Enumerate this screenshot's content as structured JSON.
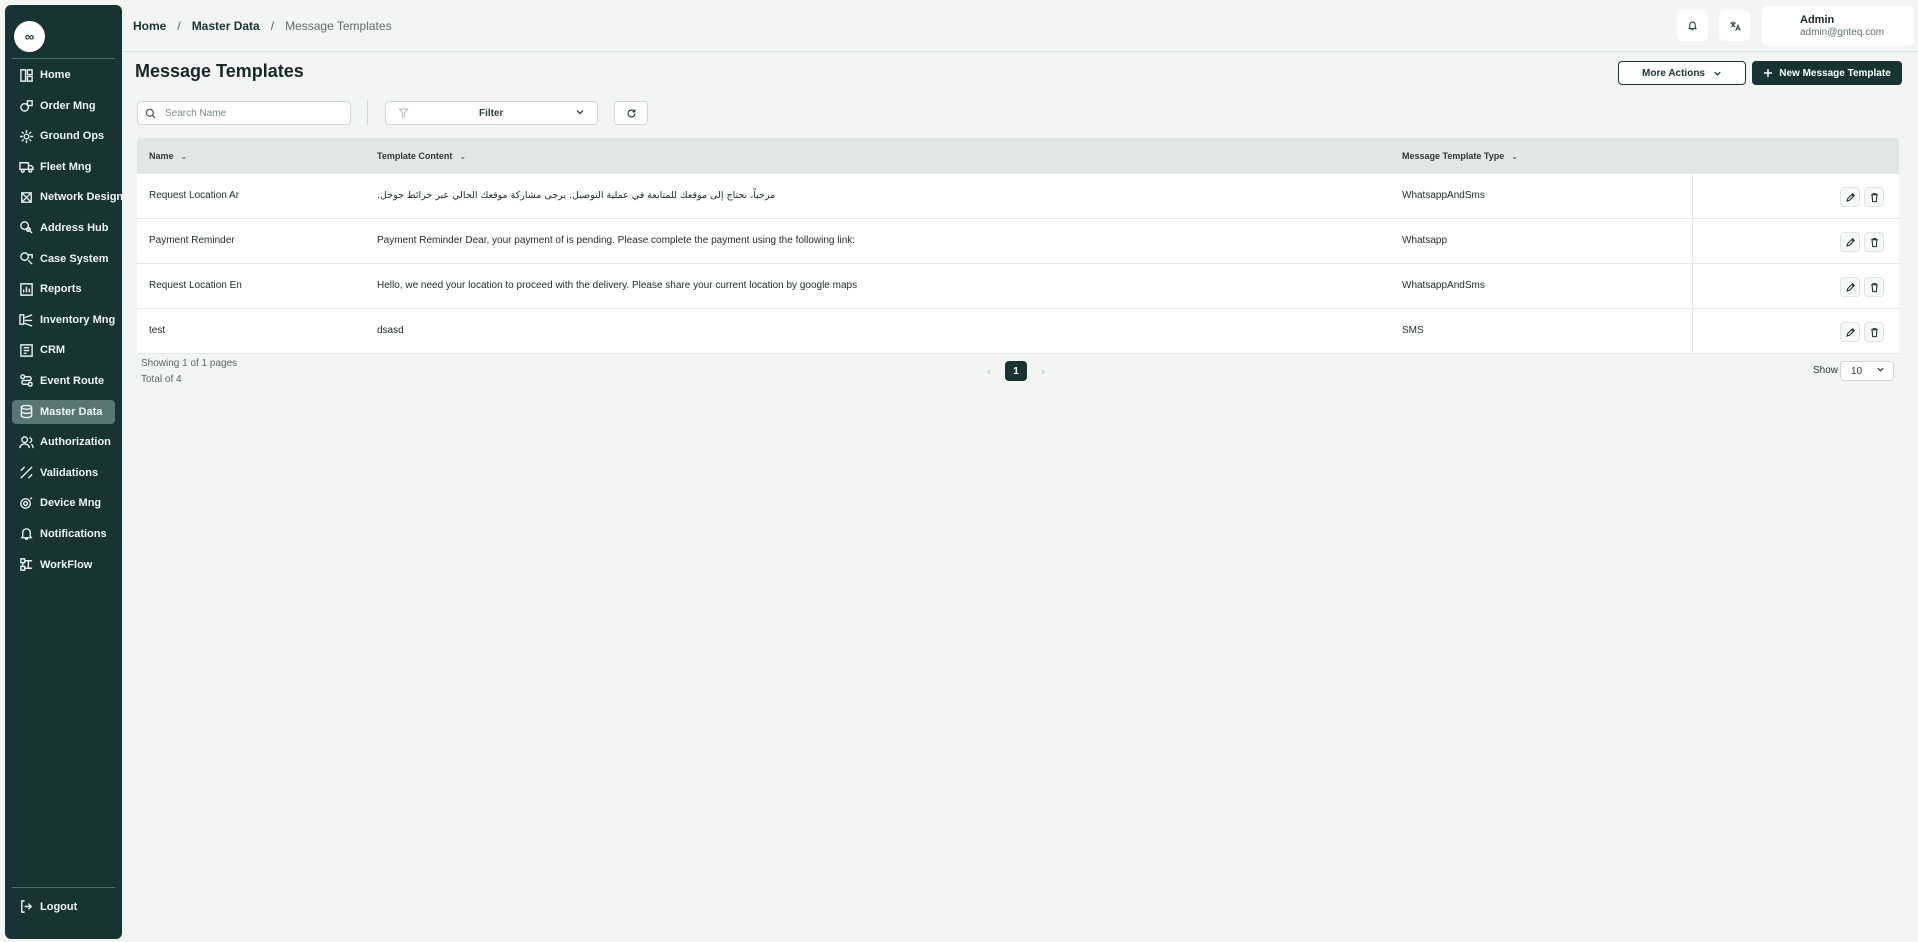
{
  "sidebar": {
    "logo_glyph": "∞",
    "items": [
      {
        "label": "Home",
        "icon": "home-icon"
      },
      {
        "label": "Order Mng",
        "icon": "order-icon"
      },
      {
        "label": "Ground Ops",
        "icon": "ground-ops-icon"
      },
      {
        "label": "Fleet Mng",
        "icon": "truck-icon"
      },
      {
        "label": "Network Design",
        "icon": "network-icon"
      },
      {
        "label": "Address Hub",
        "icon": "address-icon"
      },
      {
        "label": "Case System",
        "icon": "case-icon"
      },
      {
        "label": "Reports",
        "icon": "reports-icon"
      },
      {
        "label": "Inventory Mng",
        "icon": "inventory-icon"
      },
      {
        "label": "CRM",
        "icon": "crm-icon"
      },
      {
        "label": "Event Route",
        "icon": "route-icon"
      },
      {
        "label": "Master Data",
        "icon": "database-icon",
        "active": true
      },
      {
        "label": "Authorization",
        "icon": "users-icon"
      },
      {
        "label": "Validations",
        "icon": "validations-icon"
      },
      {
        "label": "Device Mng",
        "icon": "device-icon"
      },
      {
        "label": "Notifications",
        "icon": "bell-icon"
      },
      {
        "label": "WorkFlow",
        "icon": "workflow-icon"
      }
    ],
    "logout_label": "Logout"
  },
  "breadcrumb": {
    "home": "Home",
    "section": "Master Data",
    "current": "Message Templates",
    "separator": "/"
  },
  "user": {
    "name": "Admin",
    "email": "admin@gnteq.com"
  },
  "page": {
    "title": "Message Templates",
    "more_actions_label": "More Actions",
    "new_button_label": "New Message Template"
  },
  "toolbar": {
    "search_placeholder": "Search Name",
    "filter_label": "Filter"
  },
  "table": {
    "columns": [
      "Name",
      "Template Content",
      "Message Template Type"
    ],
    "rows": [
      {
        "name": "Request Location Ar",
        "content": "مرحباً، نحتاج إلى موقعك للمتابعة في عملية التوصيل. يرجى مشاركة موقعك الحالي عبر خرائط جوجل.",
        "type": "WhatsappAndSms",
        "rtl": true
      },
      {
        "name": "Payment Reminder",
        "content": "Payment Reminder Dear, your payment of is pending. Please complete the payment using the following link:",
        "type": "Whatsapp"
      },
      {
        "name": "Request Location En",
        "content": "Hello, we need your location to proceed with the delivery. Please share your current location by google maps",
        "type": "WhatsappAndSms"
      },
      {
        "name": "test",
        "content": "dsasd",
        "type": "SMS"
      }
    ]
  },
  "pagination": {
    "showing_text": "Showing 1 of 1 pages",
    "total_text": "Total of 4",
    "current_page": "1",
    "show_label": "Show",
    "page_size": "10"
  },
  "colors": {
    "sidebar_bg": "#173334",
    "primary": "#173334",
    "page_bg": "#f3f5f4",
    "header_row_bg": "#e2e7e6"
  }
}
